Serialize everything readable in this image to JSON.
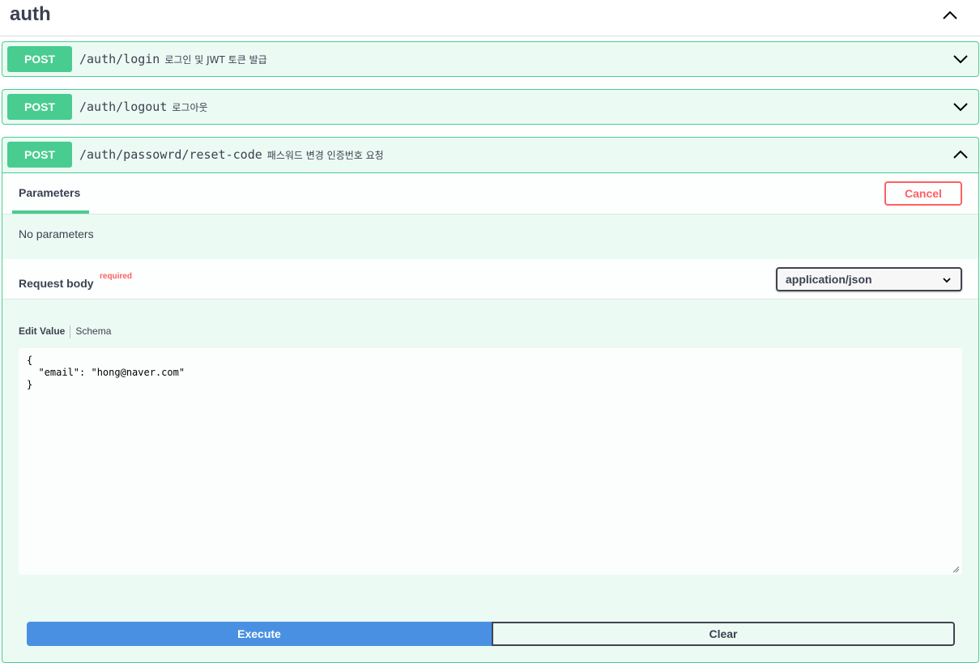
{
  "tag": {
    "title": "auth",
    "chevron_icon": "chevron-up-icon"
  },
  "operations": [
    {
      "method": "POST",
      "path": "/auth/login",
      "description": "로그인 및 JWT 토큰 발급",
      "expanded": false
    },
    {
      "method": "POST",
      "path": "/auth/logout",
      "description": "로그아웃",
      "expanded": false
    },
    {
      "method": "POST",
      "path": "/auth/passowrd/reset-code",
      "description": "패스워드 변경 인증번호 요청",
      "expanded": true
    }
  ],
  "detail": {
    "parameters_tab": "Parameters",
    "cancel_label": "Cancel",
    "no_parameters": "No parameters",
    "request_body_label": "Request body",
    "required_label": "required",
    "content_type": "application/json",
    "edit_value_tab": "Edit Value",
    "schema_tab": "Schema",
    "body_value": "{\n  \"email\": \"hong@naver.com\"\n}",
    "execute_label": "Execute",
    "clear_label": "Clear"
  },
  "colors": {
    "post": "#49cc90",
    "execute": "#4990e2",
    "cancel": "#ff6060",
    "text": "#3b4151"
  }
}
